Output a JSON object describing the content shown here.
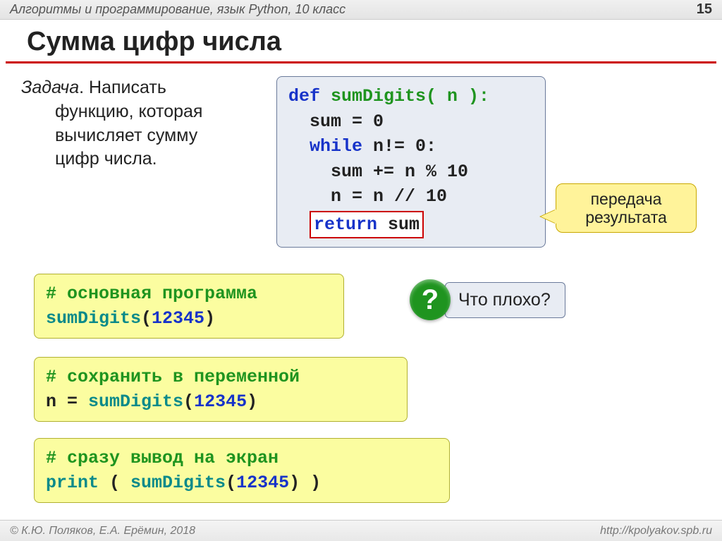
{
  "header": {
    "subject": "Алгоритмы и программирование, язык Python, 10 класс",
    "page": "15"
  },
  "title": "Сумма цифр числа",
  "task": {
    "label": "Задача",
    "text_l1": ". Написать",
    "text_l2": "функцию, которая",
    "text_l3": "вычисляет сумму",
    "text_l4": "цифр числа."
  },
  "code_main": {
    "l1a": "def",
    "l1b": " sumDigits( n ):",
    "l2": "  sum = 0",
    "l3a": "  while",
    "l3b": " n!= 0:",
    "l4": "    sum += n % 10",
    "l5": "    n = n // 10",
    "ret_kw": "return",
    "ret_rest": " sum"
  },
  "callout": "передача результата",
  "box1": {
    "comment": "# основная программа",
    "call_fn": "sumDigits",
    "call_open": "(",
    "call_arg": "12345",
    "call_close": ")"
  },
  "box2": {
    "comment": "# сохранить в переменной",
    "assign": "n = ",
    "fn": "sumDigits",
    "open": "(",
    "arg": "12345",
    "close": ")"
  },
  "box3": {
    "comment": "# сразу вывод на экран",
    "print": "print",
    "sp": " ( ",
    "fn": "sumDigits",
    "open": "(",
    "arg": "12345",
    "close": ") )"
  },
  "question": {
    "mark": "?",
    "text": "Что плохо?"
  },
  "footer": {
    "left": "© К.Ю. Поляков, Е.А. Ерёмин, 2018",
    "right": "http://kpolyakov.spb.ru"
  }
}
